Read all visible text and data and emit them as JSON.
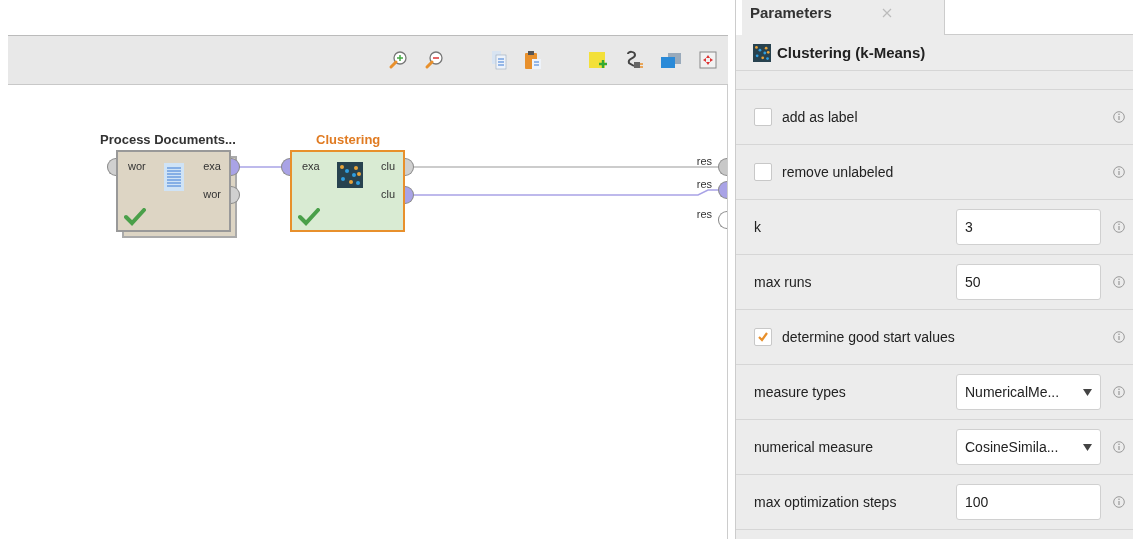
{
  "process": {
    "operators": [
      {
        "title": "Process Documents...",
        "selected": false,
        "stacked": true,
        "status_ok": true,
        "color": "#ddd5c4",
        "inputs": [
          {
            "label": "wor",
            "color": "#d0d0d0"
          }
        ],
        "outputs": [
          {
            "label": "exa",
            "color": "#a9a3e6"
          },
          {
            "label": "wor",
            "color": "#d0d0d0"
          }
        ]
      },
      {
        "title": "Clustering",
        "selected": true,
        "stacked": false,
        "status_ok": true,
        "color": "#d9ebd3",
        "inputs": [
          {
            "label": "exa",
            "color": "#a9a3e6"
          }
        ],
        "outputs": [
          {
            "label": "clu",
            "color": "#d0d0d0"
          },
          {
            "label": "clu",
            "color": "#a9a3e6"
          }
        ]
      }
    ],
    "results": [
      {
        "label": "res",
        "color": "#c8c8c8"
      },
      {
        "label": "res",
        "color": "#a9a3e6"
      },
      {
        "label": "res",
        "color": "#ffffff"
      }
    ]
  },
  "panel": {
    "tab": {
      "label": "Parameters",
      "selected": true
    },
    "operator_title": "Clustering (k-Means)",
    "parameters": [
      {
        "kind": "checkbox",
        "label": "add as label",
        "checked": false
      },
      {
        "kind": "checkbox",
        "label": "remove unlabeled",
        "checked": false
      },
      {
        "kind": "number",
        "label": "k",
        "value": "3"
      },
      {
        "kind": "number",
        "label": "max runs",
        "value": "50"
      },
      {
        "kind": "checkbox",
        "label": "determine good start values",
        "checked": true
      },
      {
        "kind": "select",
        "label": "measure types",
        "value": "NumericalMe..."
      },
      {
        "kind": "select",
        "label": "numerical measure",
        "value": "CosineSimila..."
      },
      {
        "kind": "number",
        "label": "max optimization steps",
        "value": "100"
      }
    ]
  }
}
